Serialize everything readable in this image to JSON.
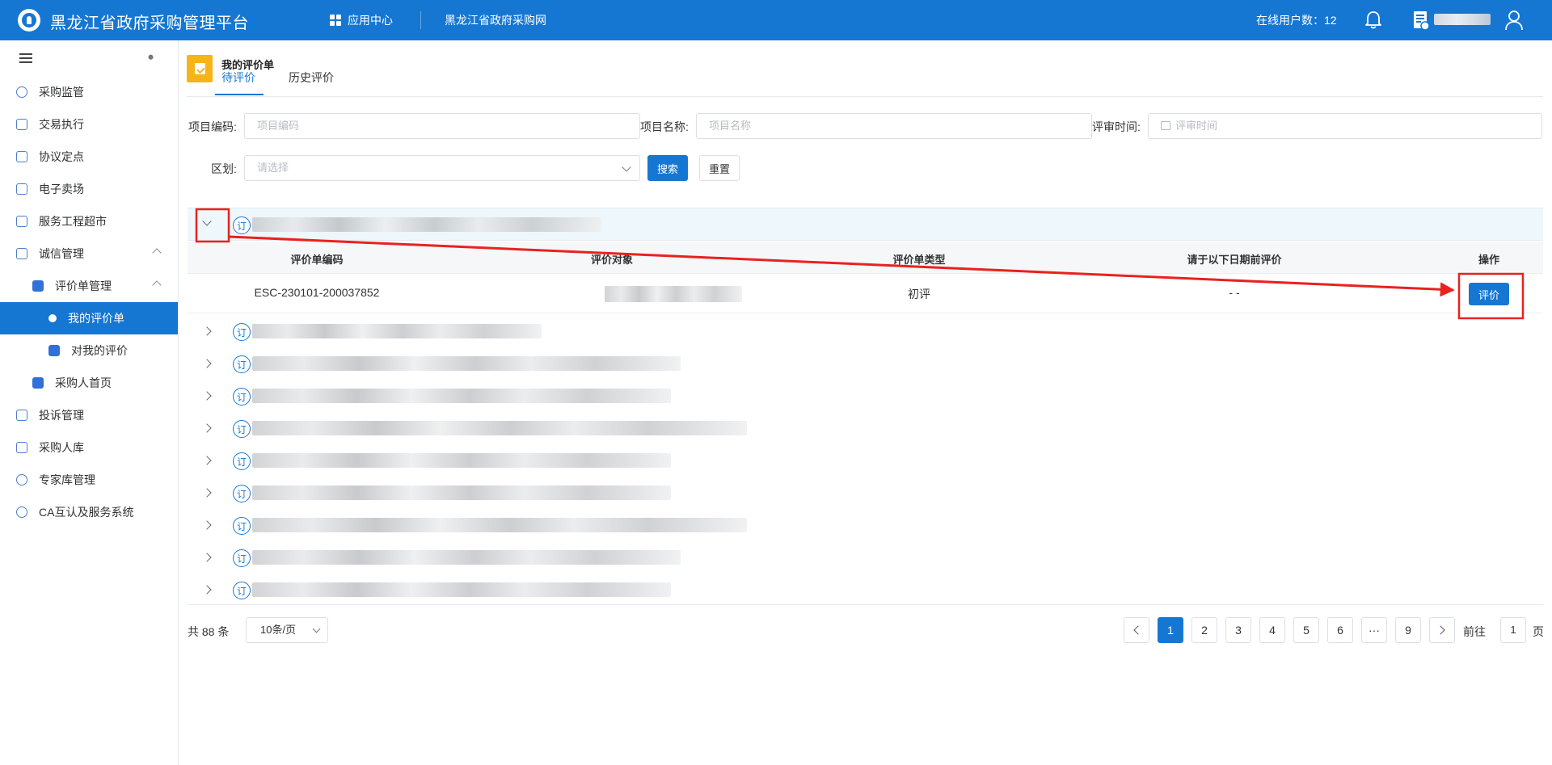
{
  "header": {
    "title": "黑龙江省政府采购管理平台",
    "app_center": "应用中心",
    "portal": "黑龙江省政府采购网",
    "online_users": "在线用户数：12"
  },
  "sidebar": {
    "items": [
      {
        "label": "采购监管"
      },
      {
        "label": "交易执行"
      },
      {
        "label": "协议定点"
      },
      {
        "label": "电子卖场"
      },
      {
        "label": "服务工程超市"
      },
      {
        "label": "诚信管理"
      },
      {
        "label": "评价单管理"
      },
      {
        "label": "我的评价单"
      },
      {
        "label": "对我的评价"
      },
      {
        "label": "采购人首页"
      },
      {
        "label": "投诉管理"
      },
      {
        "label": "采购人库"
      },
      {
        "label": "专家库管理"
      },
      {
        "label": "CA互认及服务系统"
      }
    ]
  },
  "page": {
    "title": "我的评价单",
    "tabs": [
      "待评价",
      "历史评价"
    ]
  },
  "filters": {
    "code_label": "项目编码:",
    "code_placeholder": "项目编码",
    "name_label": "项目名称:",
    "name_placeholder": "项目名称",
    "time_label": "评审时间:",
    "time_placeholder": "评审时间",
    "region_label": "区划:",
    "region_placeholder": "请选择",
    "search": "搜索",
    "reset": "重置"
  },
  "list": {
    "order_icon": "订",
    "columns": [
      "评价单编码",
      "评价对象",
      "评价单类型",
      "请于以下日期前评价",
      "操作"
    ],
    "expanded_row": {
      "code": "ESC-230101-200037852",
      "type": "初评",
      "deadline": "- -",
      "action": "评价"
    }
  },
  "pagination": {
    "total": "共 88 条",
    "page_size": "10条/页",
    "pages": [
      "1",
      "2",
      "3",
      "4",
      "5",
      "6",
      "···",
      "9"
    ],
    "current": "1",
    "goto_prefix": "前往",
    "goto_value": "1",
    "goto_suffix": "页"
  },
  "colors": {
    "primary": "#1677d2",
    "badge": "#f6b41a",
    "annotation": "#e8231f"
  }
}
